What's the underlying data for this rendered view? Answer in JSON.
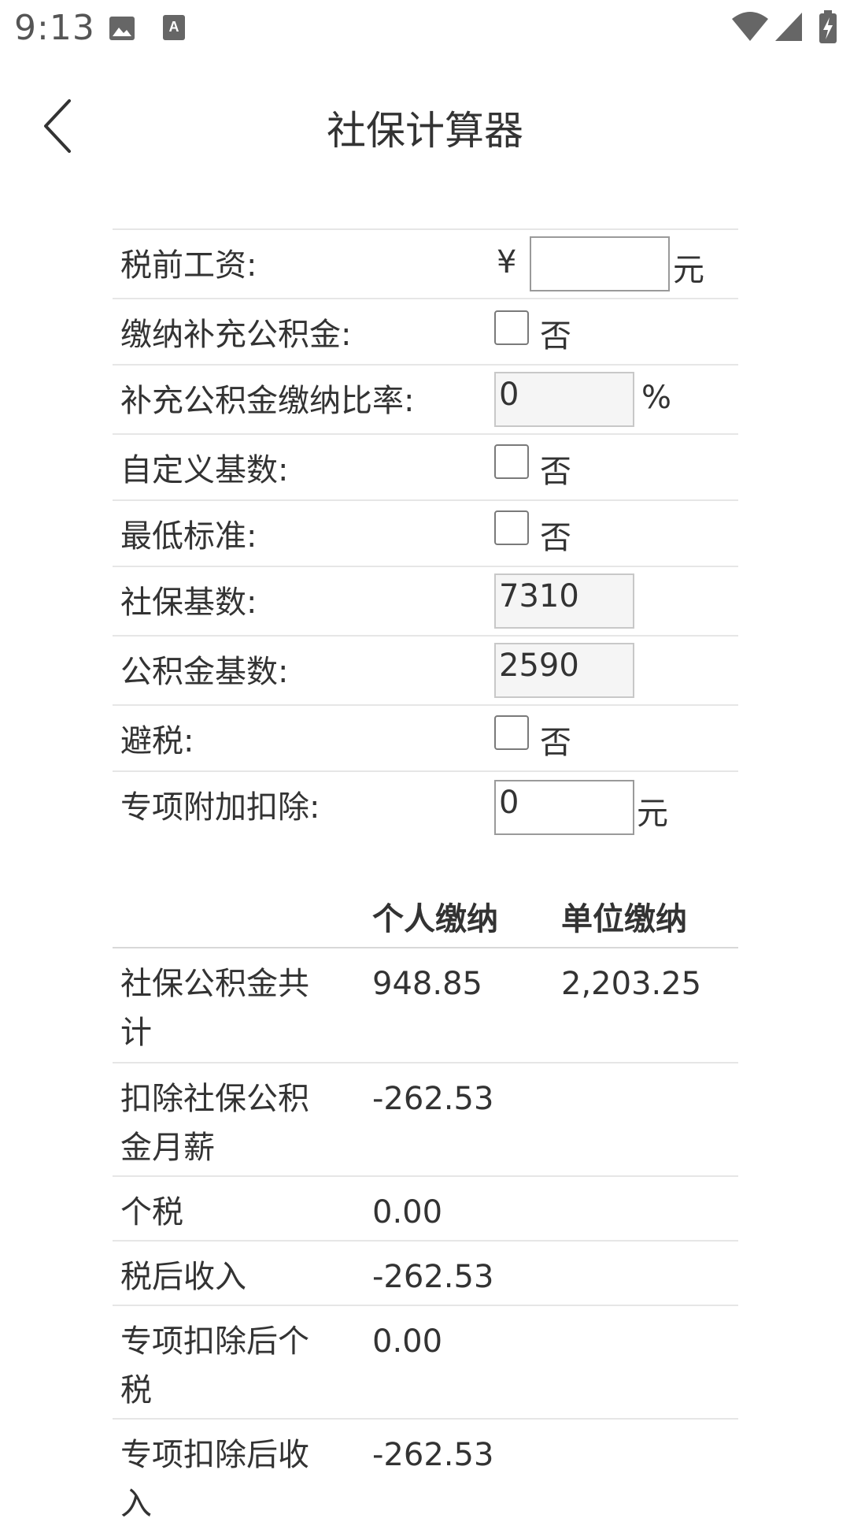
{
  "status_bar": {
    "time": "9:13",
    "icons": [
      "image-icon",
      "text-icon",
      "wifi-icon",
      "signal-icon",
      "battery-charging-icon"
    ]
  },
  "header": {
    "title": "社保计算器",
    "back_icon": "chevron-left-icon"
  },
  "form": {
    "salary": {
      "label": "税前工资:",
      "currency": "¥",
      "value": "",
      "unit": "元"
    },
    "supplementary_fund": {
      "label": "缴纳补充公积金:",
      "checked": false,
      "option": "否"
    },
    "supplementary_rate": {
      "label": "补充公积金缴纳比率:",
      "value": "0",
      "unit": "%"
    },
    "custom_base": {
      "label": "自定义基数:",
      "checked": false,
      "option": "否"
    },
    "min_standard": {
      "label": "最低标准:",
      "checked": false,
      "option": "否"
    },
    "social_base": {
      "label": "社保基数:",
      "value": "7310"
    },
    "fund_base": {
      "label": "公积金基数:",
      "value": "2590"
    },
    "tax_avoid": {
      "label": "避税:",
      "checked": false,
      "option": "否"
    },
    "special_deduction": {
      "label": "专项附加扣除:",
      "value": "0",
      "unit": "元"
    }
  },
  "results": {
    "headers": [
      "",
      "个人缴纳",
      "单位缴纳"
    ],
    "rows": [
      {
        "label": "社保公积金共计",
        "personal": "948.85",
        "company": "2,203.25"
      },
      {
        "label": "扣除社保公积金月薪",
        "personal": "-262.53",
        "company": ""
      },
      {
        "label": "个税",
        "personal": "0.00",
        "company": ""
      },
      {
        "label": "税后收入",
        "personal": "-262.53",
        "company": ""
      },
      {
        "label": "专项扣除后个税",
        "personal": "0.00",
        "company": ""
      },
      {
        "label": "专项扣除后收入",
        "personal": "-262.53",
        "company": ""
      }
    ]
  },
  "colors": {
    "text": "#333333",
    "divider": "#e6e6e6",
    "disabled_input": "#f5f5f5"
  }
}
